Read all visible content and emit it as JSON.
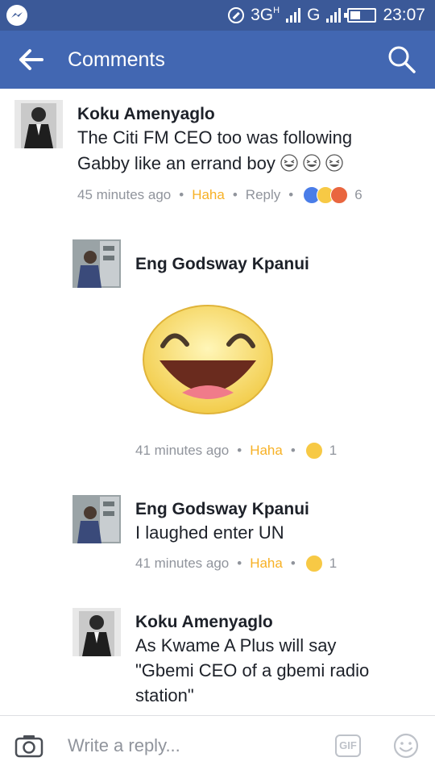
{
  "status_bar": {
    "network": "3G",
    "network_sup": "H",
    "network2": "G",
    "time": "23:07"
  },
  "app_bar": {
    "title": "Comments"
  },
  "comments": [
    {
      "name": "Koku Amenyaglo",
      "lines": [
        "The Citi FM CEO too was following",
        "Gabby like an errand boy"
      ],
      "time": "45 minutes ago",
      "reaction_label": "Haha",
      "reply_label": "Reply",
      "reaction_count": "6"
    },
    {
      "name": "Eng Godsway Kpanui",
      "time": "41 minutes ago",
      "reaction_label": "Haha",
      "reaction_count": "1"
    },
    {
      "name": "Eng Godsway Kpanui",
      "lines": [
        "I laughed enter UN"
      ],
      "time": "41 minutes ago",
      "reaction_label": "Haha",
      "reaction_count": "1"
    },
    {
      "name": "Koku Amenyaglo",
      "lines": [
        "As Kwame A Plus will say",
        "\"Gbemi CEO of a gbemi radio",
        "station\""
      ]
    }
  ],
  "reply_bar": {
    "placeholder": "Write a reply...",
    "gif_label": "GIF"
  },
  "colors": {
    "status_bar": "#3b5998",
    "app_bar": "#4267b2",
    "haha": "#f7b125",
    "meta_gray": "#90949c"
  }
}
